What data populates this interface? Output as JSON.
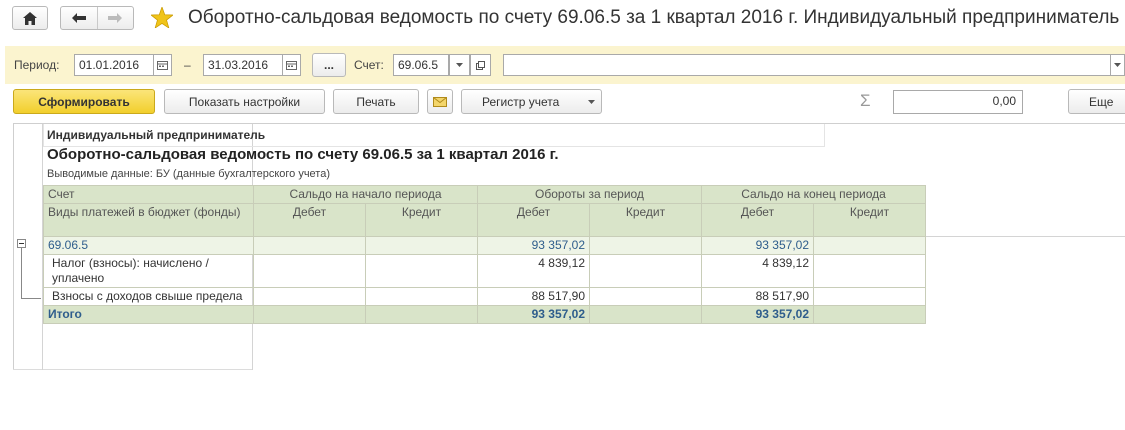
{
  "window": {
    "title": "Оборотно-сальдовая ведомость по счету 69.06.5 за 1 квартал 2016 г. Индивидуальный предприниматель ."
  },
  "toolbar": {
    "period_label": "Период:",
    "date_from": "01.01.2016",
    "date_dash": "–",
    "date_to": "31.03.2016",
    "dots_label": "...",
    "account_label": "Счет:",
    "account_value": "69.06.5",
    "org_value": ""
  },
  "actions": {
    "generate_label": "Сформировать",
    "settings_label": "Показать настройки",
    "print_label": "Печать",
    "register_label": "Регистр учета",
    "sum_value": "0,00",
    "more_label": "Еще"
  },
  "report": {
    "org_name": "Индивидуальный предприниматель",
    "title": "Оборотно-сальдовая ведомость по счету 69.06.5 за 1 квартал 2016 г.",
    "data_shown": "Выводимые данные:  БУ (данные бухгалтерского учета)",
    "columns": {
      "account": "Счет",
      "opening": "Сальдо на начало периода",
      "turnover": "Обороты за период",
      "closing": "Сальдо на конец периода",
      "payment_types": "Виды платежей в бюджет (фонды)",
      "debit": "Дебет",
      "credit": "Кредит"
    },
    "rows": [
      {
        "name": "69.06.5",
        "open_d": "",
        "open_c": "",
        "turn_d": "93 357,02",
        "turn_c": "",
        "close_d": "93 357,02",
        "close_c": ""
      },
      {
        "name": "Налог (взносы): начислено / уплачено",
        "open_d": "",
        "open_c": "",
        "turn_d": "4 839,12",
        "turn_c": "",
        "close_d": "4 839,12",
        "close_c": ""
      },
      {
        "name": "Взносы с доходов свыше предела",
        "open_d": "",
        "open_c": "",
        "turn_d": "88 517,90",
        "turn_c": "",
        "close_d": "88 517,90",
        "close_c": ""
      }
    ],
    "total": {
      "name": "Итого",
      "turn_d": "93 357,02",
      "close_d": "93 357,02"
    }
  },
  "colors": {
    "toolbar_bg": "#fbf4cf",
    "generate_button": "#f5d63b",
    "header_bg": "#d9e4c9",
    "star": "#f0c419"
  },
  "icons": [
    "home-icon",
    "back-arrow-icon",
    "forward-arrow-icon",
    "star-icon",
    "calendar-icon",
    "dropdown-arrow-icon",
    "open-icon",
    "mail-icon",
    "sigma-icon",
    "collapse-icon"
  ]
}
